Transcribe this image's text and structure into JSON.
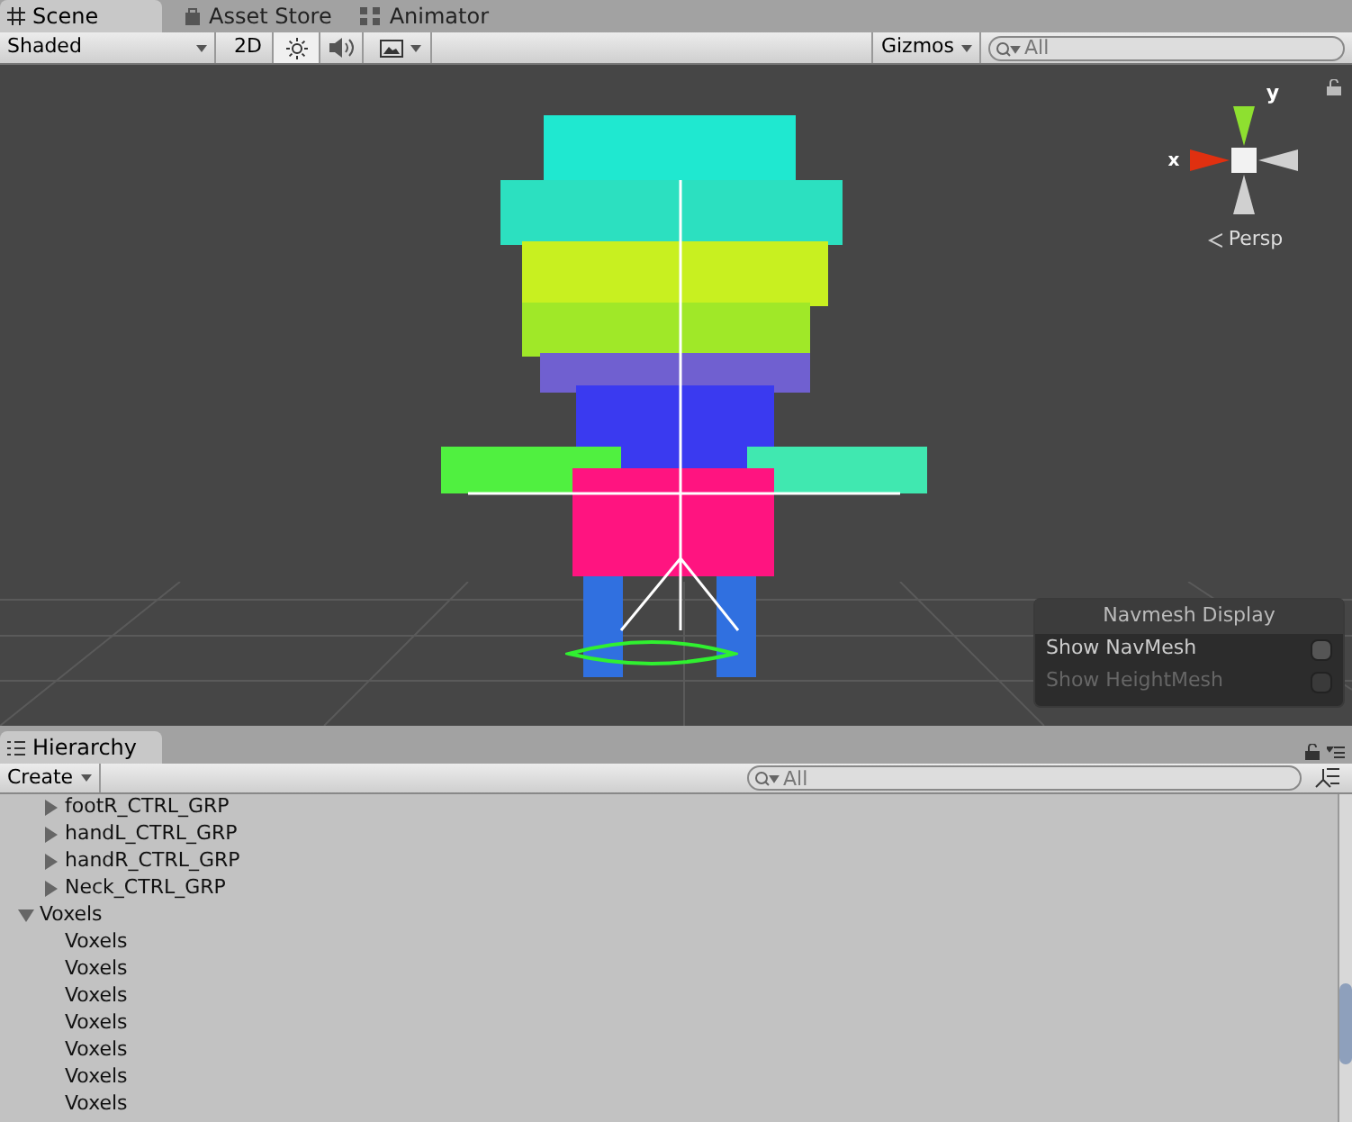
{
  "tabs": [
    {
      "label": "Scene",
      "selected": true
    },
    {
      "label": "Asset Store",
      "selected": false
    },
    {
      "label": "Animator",
      "selected": false
    }
  ],
  "scene_toolbar": {
    "shading": "Shaded",
    "mode_2d": {
      "label": "2D",
      "on": false
    },
    "lighting_on": true,
    "audio_on": false,
    "effects_on": false,
    "gizmos": "Gizmos",
    "search": {
      "placeholder": "All"
    }
  },
  "gizmo": {
    "y_label": "y",
    "x_label": "x",
    "projection": "Persp"
  },
  "navmesh": {
    "title": "Navmesh Display",
    "options": [
      {
        "label": "Show NavMesh",
        "checked": false,
        "disabled": false
      },
      {
        "label": "Show HeightMesh",
        "checked": false,
        "disabled": true
      }
    ]
  },
  "hierarchy": {
    "title": "Hierarchy",
    "create": "Create",
    "search": {
      "placeholder": "All"
    },
    "nested_rows": [
      {
        "label": "footR_CTRL_GRP",
        "expanded": false
      },
      {
        "label": "handL_CTRL_GRP",
        "expanded": false
      },
      {
        "label": "handR_CTRL_GRP",
        "expanded": false
      },
      {
        "label": "Neck_CTRL_GRP",
        "expanded": false
      }
    ],
    "tree": [
      {
        "label": "Voxels",
        "expanded": true,
        "children": [
          {
            "label": "Voxels"
          },
          {
            "label": "Voxels"
          },
          {
            "label": "Voxels"
          },
          {
            "label": "Voxels"
          },
          {
            "label": "Voxels"
          },
          {
            "label": "Voxels"
          },
          {
            "label": "Voxels"
          }
        ]
      }
    ]
  }
}
